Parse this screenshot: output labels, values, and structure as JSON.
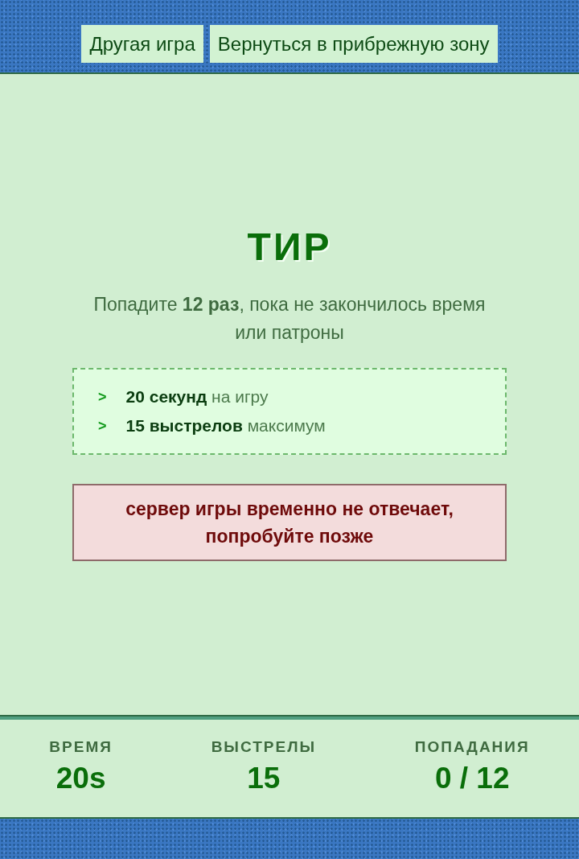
{
  "nav": {
    "buttons": [
      {
        "label": "Другая игра"
      },
      {
        "label": "Вернуться в прибрежную зону"
      }
    ]
  },
  "game": {
    "title": "ТИР",
    "description": "Попадите **12 раз**, пока не закончилось время или патроны",
    "rules": [
      {
        "marker": ">",
        "text": "**20 секунд** на игру"
      },
      {
        "marker": ">",
        "text": "**15 выстрелов** максимум"
      }
    ],
    "error": "сервер игры временно не отвечает, попробуйте позже"
  },
  "stats": [
    {
      "label": "ВРЕМЯ",
      "value": "20s"
    },
    {
      "label": "ВЫСТРЕЛЫ",
      "value": "15"
    },
    {
      "label": "ПОПАДАНИЯ",
      "value": "0 / 12"
    }
  ]
}
